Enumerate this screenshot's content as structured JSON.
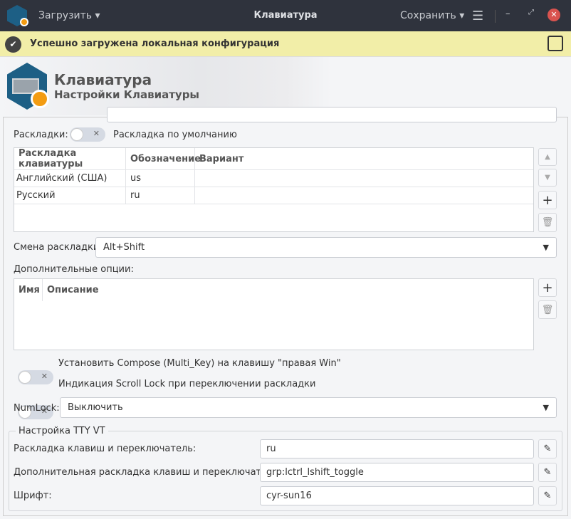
{
  "titlebar": {
    "load_label": "Загрузить",
    "title": "Клавиатура",
    "save_label": "Сохранить"
  },
  "infobar": {
    "message": "Успешно загружена локальная конфигурация"
  },
  "header": {
    "title": "Клавиатура",
    "subtitle": "Настройки Клавиатуры"
  },
  "layouts": {
    "label": "Раскладки:",
    "toggle_label": "Раскладка по умолчанию",
    "columns": [
      "Раскладка клавиатуры",
      "Обозначение",
      "Вариант"
    ],
    "rows": [
      [
        "Английский (США)",
        "us",
        ""
      ],
      [
        "Русский",
        "ru",
        ""
      ]
    ]
  },
  "switch": {
    "label": "Смена раскладки:",
    "value": "Alt+Shift"
  },
  "options": {
    "label": "Дополнительные опции:",
    "columns": [
      "Имя",
      "Описание"
    ]
  },
  "toggles": [
    {
      "label": "Установить Compose (Multi_Key) на клавишу \"правая Win\""
    },
    {
      "label": "Индикация Scroll Lock при переключении раскладки"
    }
  ],
  "numlock": {
    "label": "NumLock:",
    "value": "Выключить"
  },
  "tty": {
    "title": "Настройка TTY VT",
    "rows": [
      {
        "label": "Раскладка клавиш и переключатель:",
        "value": "ru"
      },
      {
        "label": "Дополнительная раскладка клавиш и переключатель:",
        "value": "grp:lctrl_lshift_toggle"
      },
      {
        "label": "Шрифт:",
        "value": "cyr-sun16"
      }
    ]
  },
  "colors": {
    "titlebar": "#2f333d",
    "infobar": "#f2eea8",
    "accent": "#f39c12",
    "close": "#d9534f"
  }
}
